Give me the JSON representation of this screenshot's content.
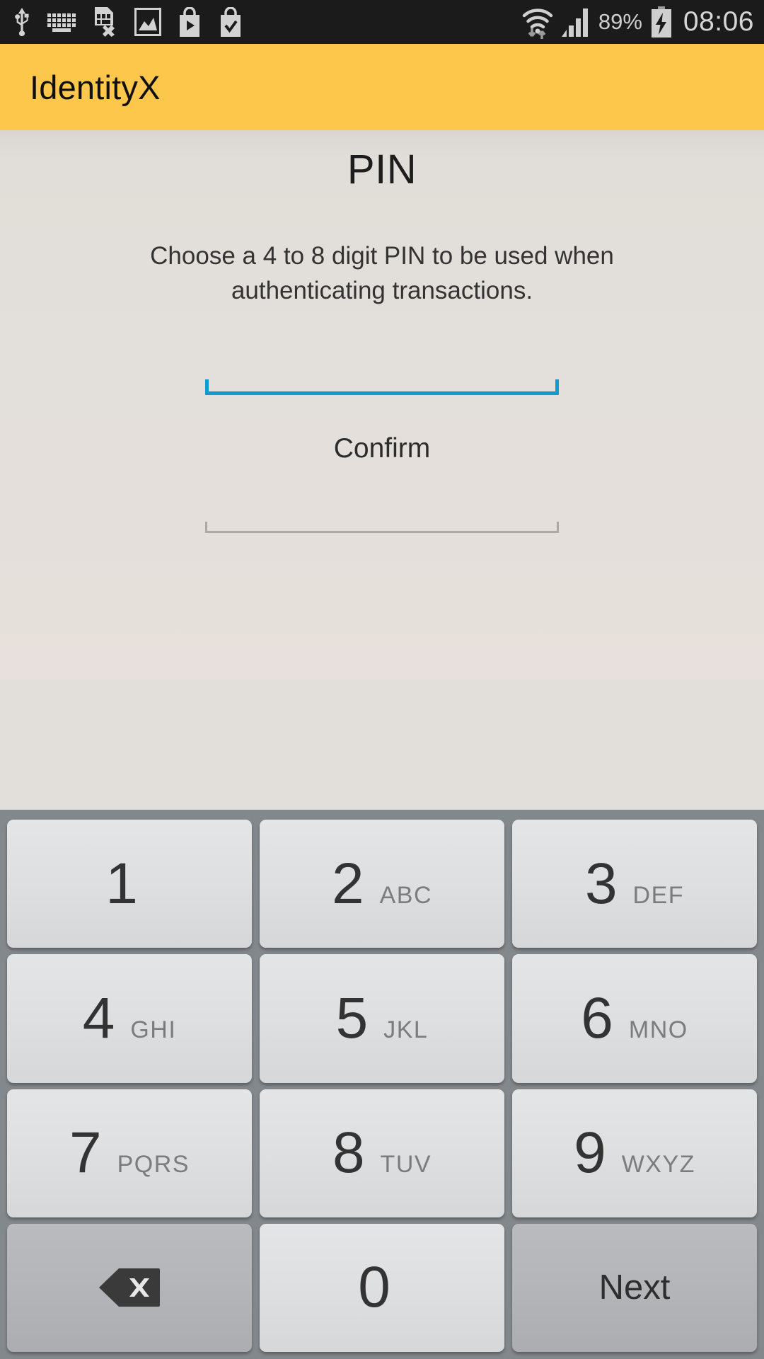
{
  "status_bar": {
    "left_icons": [
      {
        "name": "usb-icon",
        "label": "USB connected"
      },
      {
        "name": "keyboard-icon",
        "label": "Keyboard active"
      },
      {
        "name": "sim-error-icon",
        "label": "SIM card error"
      },
      {
        "name": "screenshot-icon",
        "label": "Screenshot captured"
      },
      {
        "name": "play-store-icon",
        "label": "Play Store"
      },
      {
        "name": "app-installed-icon",
        "label": "App installed"
      }
    ],
    "wifi_icon": "wifi-signal-icon",
    "cellular_icon": "cellular-signal-icon",
    "battery_percent": "89%",
    "battery_icon": "battery-charging-icon",
    "clock": "08:06"
  },
  "app_bar": {
    "title": "IdentityX",
    "background": "#FCC74B"
  },
  "content": {
    "page_title": "PIN",
    "instructions": "Choose a 4 to 8 digit PIN to be used when authenticating transactions.",
    "pin_field": {
      "name": "pin-input",
      "value": "",
      "placeholder": "",
      "focused": true,
      "accent_color": "#0F9BD0"
    },
    "confirm_label": "Confirm",
    "confirm_field": {
      "name": "confirm-pin-input",
      "value": "",
      "placeholder": "",
      "focused": false,
      "line_color": "#ACA9A6"
    }
  },
  "keypad": {
    "rows": [
      [
        {
          "type": "num",
          "digit": "1",
          "letters": ""
        },
        {
          "type": "num",
          "digit": "2",
          "letters": "ABC"
        },
        {
          "type": "num",
          "digit": "3",
          "letters": "DEF"
        }
      ],
      [
        {
          "type": "num",
          "digit": "4",
          "letters": "GHI"
        },
        {
          "type": "num",
          "digit": "5",
          "letters": "JKL"
        },
        {
          "type": "num",
          "digit": "6",
          "letters": "MNO"
        }
      ],
      [
        {
          "type": "num",
          "digit": "7",
          "letters": "PQRS"
        },
        {
          "type": "num",
          "digit": "8",
          "letters": "TUV"
        },
        {
          "type": "num",
          "digit": "9",
          "letters": "WXYZ"
        }
      ],
      [
        {
          "type": "fn",
          "icon": "backspace-icon",
          "label": ""
        },
        {
          "type": "num",
          "digit": "0",
          "letters": ""
        },
        {
          "type": "fn",
          "label": "Next"
        }
      ]
    ],
    "background": "#83888D"
  }
}
